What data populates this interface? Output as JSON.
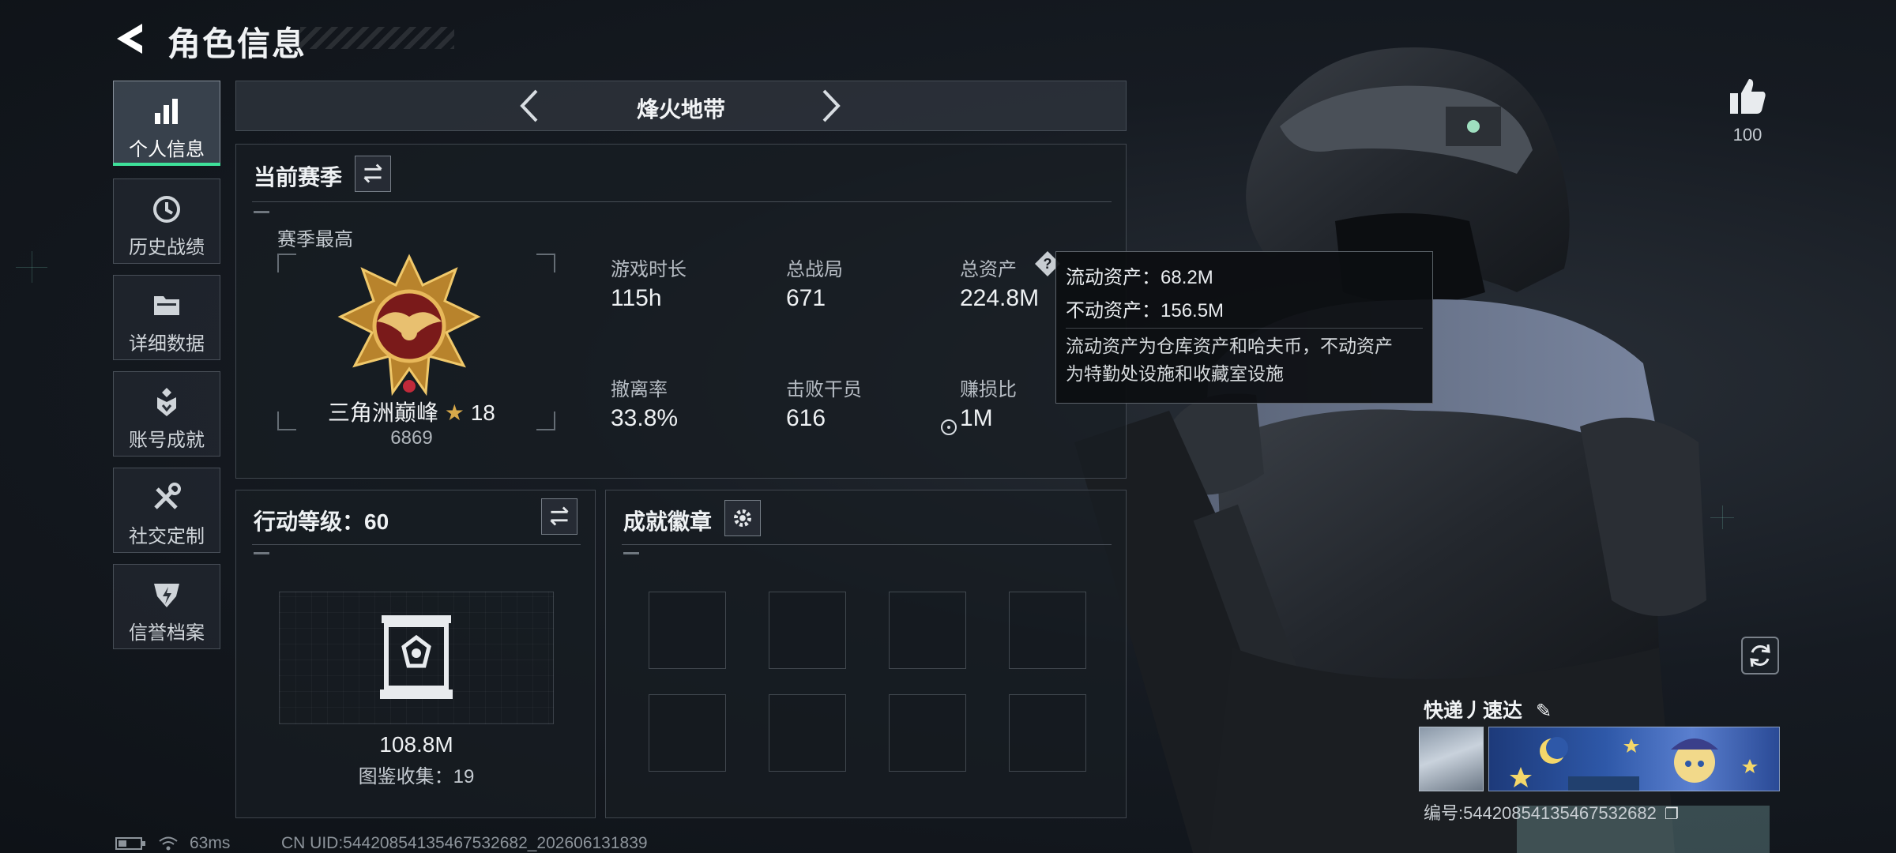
{
  "header": {
    "title": "角色信息"
  },
  "sidebar": {
    "items": [
      {
        "label": "个人信息",
        "icon": "bar-chart-icon",
        "active": true
      },
      {
        "label": "历史战绩",
        "icon": "history-clock-icon"
      },
      {
        "label": "详细数据",
        "icon": "folder-icon"
      },
      {
        "label": "账号成就",
        "icon": "achievement-icon"
      },
      {
        "label": "社交定制",
        "icon": "tools-icon"
      },
      {
        "label": "信誉档案",
        "icon": "credit-shield-icon"
      }
    ]
  },
  "mode": {
    "label": "烽火地带"
  },
  "season": {
    "title": "当前赛季",
    "best_label": "赛季最高",
    "rank_name": "三角洲巅峰",
    "rank_stars": "18",
    "rank_score": "6869",
    "stats": [
      {
        "label": "游戏时长",
        "value": "115h"
      },
      {
        "label": "总战局",
        "value": "671"
      },
      {
        "label": "总资产",
        "value": "224.8M"
      },
      {
        "label": "撤离率",
        "value": "33.8%"
      },
      {
        "label": "击败干员",
        "value": "616"
      },
      {
        "label": "赚损比",
        "value": "1M"
      }
    ]
  },
  "tooltip": {
    "liquid": "流动资产：68.2M",
    "fixed": "不动资产：156.5M",
    "desc_line1": "流动资产为仓库资产和哈夫币，不动资产",
    "desc_line2": "为特勤处设施和收藏室设施"
  },
  "action_level": {
    "title": "行动等级：60",
    "value": "108.8M",
    "collection": "图鉴收集：19"
  },
  "badges": {
    "title": "成就徽章",
    "slots": 8
  },
  "profile": {
    "likes": "100",
    "name": "快递丿速达",
    "uid_label": "编号:5442085413546753268​2"
  },
  "status": {
    "ping": "63ms",
    "cn_uid": "CN UID:54420854135467532682_202606131839"
  },
  "colors": {
    "accent": "#3ee19a",
    "gold": "#d8a94a",
    "panel": "#181d23"
  }
}
